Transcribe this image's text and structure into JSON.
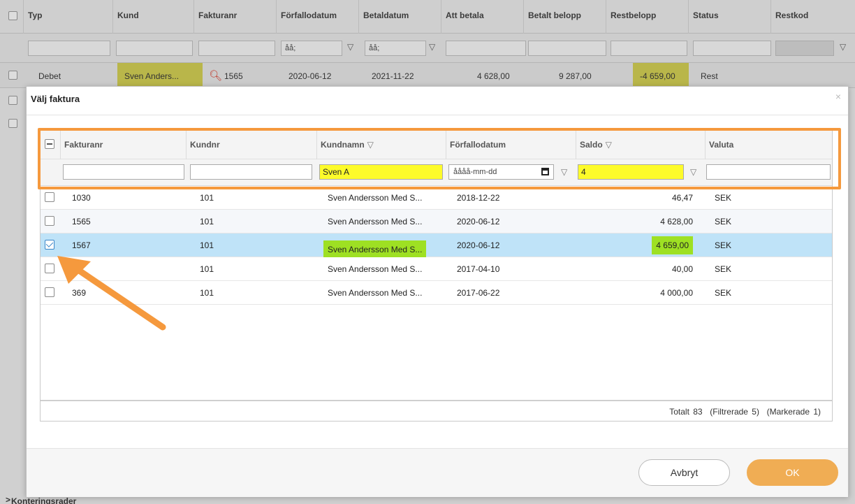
{
  "background": {
    "columns": [
      "Typ",
      "Kund",
      "Fakturanr",
      "Förfallodatum",
      "Betaldatum",
      "Att betala",
      "Betalt belopp",
      "Restbelopp",
      "Status",
      "Restkod"
    ],
    "date_placeholder": "åå;",
    "row": {
      "typ": "Debet",
      "kund": "Sven Anders...",
      "fakturanr": "1565",
      "forfallodatum": "2020-06-12",
      "betaldatum": "2021-11-22",
      "att_betala": "4 628,00",
      "betalt_belopp": "9 287,00",
      "restbelopp": "-4 659,00",
      "status": "Rest"
    },
    "bottom_label": "Konteringsrader"
  },
  "modal": {
    "title": "Välj faktura",
    "close": "×",
    "columns": [
      "Fakturanr",
      "Kundnr",
      "Kundnamn",
      "Förfallodatum",
      "Saldo",
      "Valuta"
    ],
    "filters": {
      "fakturanr": "",
      "kundnr": "",
      "kundnamn": "Sven A",
      "forfallodatum_placeholder": "åååå-mm-dd",
      "saldo": "4",
      "valuta": ""
    },
    "rows": [
      {
        "fakturanr": "1030",
        "kundnr": "101",
        "kundnamn": "Sven Andersson Med S...",
        "forfallodatum": "2018-12-22",
        "saldo": "46,47",
        "valuta": "SEK",
        "checked": false
      },
      {
        "fakturanr": "1565",
        "kundnr": "101",
        "kundnamn": "Sven Andersson Med S...",
        "forfallodatum": "2020-06-12",
        "saldo": "4 628,00",
        "valuta": "SEK",
        "checked": false
      },
      {
        "fakturanr": "1567",
        "kundnr": "101",
        "kundnamn": "Sven Andersson Med S...",
        "forfallodatum": "2020-06-12",
        "saldo": "4 659,00",
        "valuta": "SEK",
        "checked": true
      },
      {
        "fakturanr": "",
        "kundnr": "101",
        "kundnamn": "Sven Andersson Med S...",
        "forfallodatum": "2017-04-10",
        "saldo": "40,00",
        "valuta": "SEK",
        "checked": false
      },
      {
        "fakturanr": "369",
        "kundnr": "101",
        "kundnamn": "Sven Andersson Med S...",
        "forfallodatum": "2017-06-22",
        "saldo": "4 000,00",
        "valuta": "SEK",
        "checked": false
      }
    ],
    "footer": {
      "totalt": "Totalt 83",
      "filtrerade": "(Filtrerade 5)",
      "markerade": "(Markerade 1)"
    },
    "buttons": {
      "cancel": "Avbryt",
      "ok": "OK"
    }
  },
  "colors": {
    "highlight_yellow": "#fdfb2a",
    "highlight_green": "#9ee023",
    "selected_row": "#bfe3f8",
    "annotation_orange": "#f5993d",
    "ok_button": "#f0ad54"
  }
}
